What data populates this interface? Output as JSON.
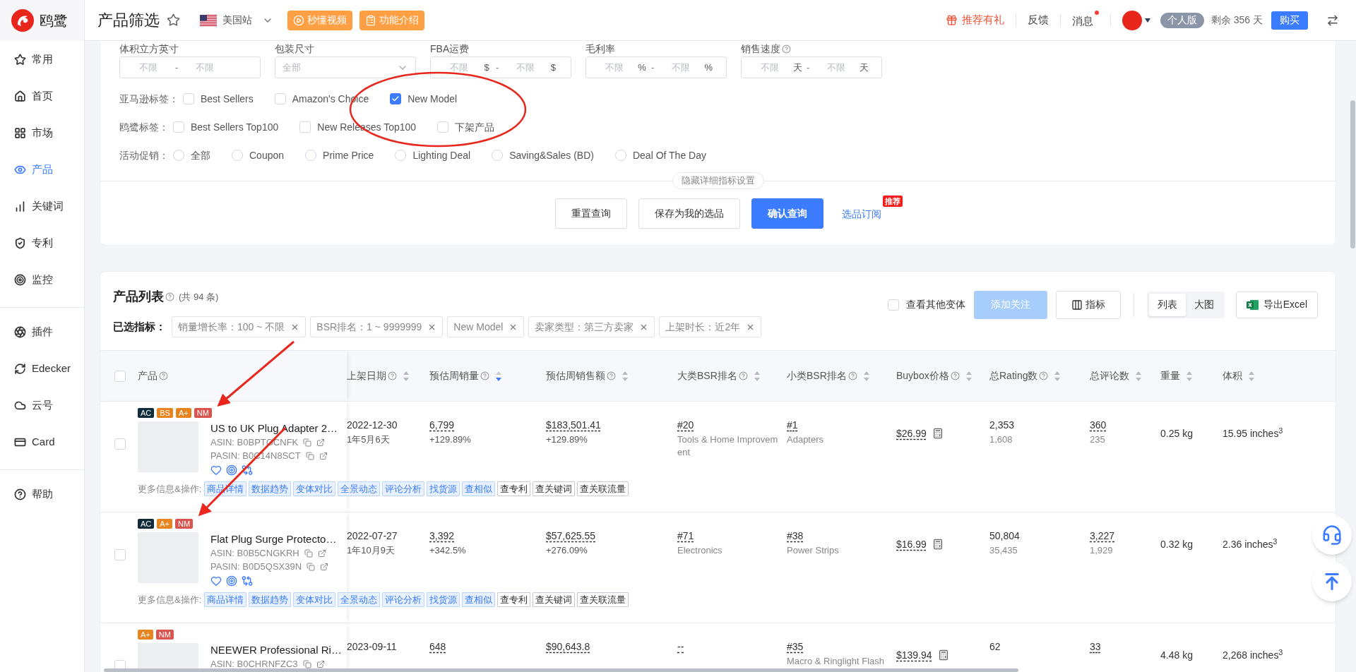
{
  "sidebar": {
    "logo": "鸥鹭",
    "sections": [
      [
        {
          "label": "常用",
          "selected": false
        },
        {
          "label": "首页",
          "selected": false
        },
        {
          "label": "市场",
          "selected": false
        },
        {
          "label": "产品",
          "selected": true
        },
        {
          "label": "关键词",
          "selected": false
        },
        {
          "label": "专利",
          "selected": false
        },
        {
          "label": "监控",
          "selected": false
        }
      ],
      [
        {
          "label": "插件",
          "selected": false
        },
        {
          "label": "Edecker",
          "selected": false
        },
        {
          "label": "云号",
          "selected": false
        },
        {
          "label": "Card",
          "selected": false
        }
      ],
      [
        {
          "label": "帮助",
          "selected": false
        }
      ]
    ]
  },
  "header": {
    "title": "产品筛选",
    "favorite": false,
    "site": "美国站",
    "guide_buttons": [
      "秒懂视频",
      "功能介绍"
    ],
    "referral": "推荐有礼",
    "feedback": "反馈",
    "messages": {
      "label": "消息",
      "unread": true
    },
    "plan": "个人版",
    "remaining": "剩余 356 天",
    "buy": "购买"
  },
  "filters": {
    "fields": [
      {
        "kind": "range",
        "label": "体积立方英寸",
        "help": false,
        "min_placeholder": "不限",
        "separator": "-",
        "max_placeholder": "不限"
      },
      {
        "kind": "select",
        "label": "包装尺寸",
        "help": false,
        "placeholder": "全部"
      },
      {
        "kind": "range",
        "label": "FBA运费",
        "help": false,
        "min_placeholder": "不限",
        "min_unit": "$",
        "separator": "-",
        "max_placeholder": "不限",
        "max_unit": "$"
      },
      {
        "kind": "range",
        "label": "毛利率",
        "help": false,
        "min_placeholder": "不限",
        "min_unit": "%",
        "separator": "-",
        "max_placeholder": "不限",
        "max_unit": "%"
      },
      {
        "kind": "range",
        "label": "销售速度",
        "help": true,
        "min_placeholder": "不限",
        "min_unit": "天",
        "separator": "-",
        "max_placeholder": "不限",
        "max_unit": "天"
      }
    ],
    "tag_groups": [
      {
        "kind": "checkbox",
        "label": "亚马逊标签：",
        "options": [
          {
            "label": "Best Sellers",
            "checked": false
          },
          {
            "label": "Amazon's Choice",
            "checked": false
          },
          {
            "label": "New Model",
            "checked": true
          }
        ]
      },
      {
        "kind": "checkbox",
        "label": "鸥鹭标签：",
        "options": [
          {
            "label": "Best Sellers Top100",
            "checked": false
          },
          {
            "label": "New Releases Top100",
            "checked": false
          },
          {
            "label": "下架产品",
            "checked": false
          }
        ]
      },
      {
        "kind": "radio",
        "label": "活动促销：",
        "options": [
          {
            "label": "全部",
            "selected": false
          },
          {
            "label": "Coupon",
            "selected": false
          },
          {
            "label": "Prime Price",
            "selected": false
          },
          {
            "label": "Lighting Deal",
            "selected": false
          },
          {
            "label": "Saving&Sales (BD)",
            "selected": false
          },
          {
            "label": "Deal Of The Day",
            "selected": false
          }
        ]
      }
    ],
    "toggle": "隐藏详细指标设置",
    "actions": [
      {
        "label": "重置查询",
        "kind": "default"
      },
      {
        "label": "保存为我的选品",
        "kind": "default"
      },
      {
        "label": "确认查询",
        "kind": "primary"
      }
    ],
    "subscribe": {
      "label": "选品订阅",
      "badge": "推荐"
    }
  },
  "product_list": {
    "title": "产品列表",
    "count": "(共 94 条)",
    "selected_label": "已选指标：",
    "chips": [
      "销量增长率：100 ~ 不限",
      "BSR排名：1 ~ 9999999",
      "New Model",
      "卖家类型：第三方卖家",
      "上架时长：近2年"
    ],
    "variants": {
      "label": "查看其他变体",
      "checked": false
    },
    "follow": {
      "label": "添加关注",
      "disabled": true
    },
    "metrics": "指标",
    "views": [
      {
        "label": "列表",
        "selected": true
      },
      {
        "label": "大图",
        "selected": false
      }
    ],
    "export": "导出Excel"
  },
  "table": {
    "product_column": {
      "label": "产品",
      "help": true,
      "checked": false
    },
    "columns": [
      {
        "label": "上架日期",
        "help": true,
        "sortable": true,
        "sorted_desc": false
      },
      {
        "label": "预估周销量",
        "help": true,
        "sortable": true,
        "sorted_desc": true
      },
      {
        "label": "预估周销售额",
        "help": true,
        "sortable": true,
        "sorted_desc": false
      },
      {
        "label": "大类BSR排名",
        "help": true,
        "sortable": true,
        "sorted_desc": false
      },
      {
        "label": "小类BSR排名",
        "help": true,
        "sortable": true,
        "sorted_desc": false
      },
      {
        "label": "Buybox价格",
        "help": true,
        "sortable": true,
        "sorted_desc": false
      },
      {
        "label": "总Rating数",
        "help": true,
        "sortable": true,
        "sorted_desc": false
      },
      {
        "label": "总评论数",
        "help": false,
        "sortable": true,
        "sorted_desc": false
      },
      {
        "label": "重量",
        "help": false,
        "sortable": true,
        "sorted_desc": false
      },
      {
        "label": "体积",
        "help": false,
        "sortable": true,
        "sorted_desc": false
      }
    ],
    "rows": [
      {
        "checked": false,
        "badges": [
          {
            "label": "AC",
            "color": "#0f2c3a"
          },
          {
            "label": "BS",
            "color": "#e8841e"
          },
          {
            "label": "A+",
            "color": "#e8841e"
          },
          {
            "label": "NM",
            "color": "#d9534f"
          }
        ],
        "title": "US to UK Plug Adapter 2…",
        "asin": "ASIN: B0BPTGCNFK",
        "pasin": "PASIN: B0C14N8SCT",
        "actions_label": "更多信息&操作:",
        "actions": [
          {
            "label": "商品详情",
            "kind": "primary"
          },
          {
            "label": "数据趋势",
            "kind": "primary"
          },
          {
            "label": "变体对比",
            "kind": "primary"
          },
          {
            "label": "全景动态",
            "kind": "primary"
          },
          {
            "label": "评论分析",
            "kind": "primary"
          },
          {
            "label": "找货源",
            "kind": "primary"
          },
          {
            "label": "查相似",
            "kind": "primary"
          },
          {
            "label": "查专利",
            "kind": "plain"
          },
          {
            "label": "查关键词",
            "kind": "plain"
          },
          {
            "label": "查关联流量",
            "kind": "plain"
          }
        ],
        "cells": [
          {
            "main": "2022-12-30",
            "sub": "1年5月6天"
          },
          {
            "main": "6,799",
            "sub": "+129.89%"
          },
          {
            "main": "$183,501.41",
            "sub": "+129.89%"
          },
          {
            "main": "#20",
            "sub": "Tools & Home Improvement"
          },
          {
            "main": "#1",
            "sub": "Adapters"
          },
          {
            "main": "$26.99"
          },
          {
            "main": "2,353",
            "sub": "1,608"
          },
          {
            "main": "360",
            "sub": "235"
          },
          {
            "main": "0.25 kg"
          },
          {
            "main": "15.95 inches$^{3}$"
          }
        ]
      },
      {
        "checked": false,
        "badges": [
          {
            "label": "AC",
            "color": "#0f2c3a"
          },
          {
            "label": "A+",
            "color": "#e8841e"
          },
          {
            "label": "NM",
            "color": "#d9534f"
          }
        ],
        "title": "Flat Plug Surge Protecto…",
        "asin": "ASIN: B0B5CNGKRH",
        "pasin": "PASIN: B0D5QSX39N",
        "actions_label": "更多信息&操作:",
        "actions": [
          {
            "label": "商品详情",
            "kind": "primary"
          },
          {
            "label": "数据趋势",
            "kind": "primary"
          },
          {
            "label": "变体对比",
            "kind": "primary"
          },
          {
            "label": "全景动态",
            "kind": "primary"
          },
          {
            "label": "评论分析",
            "kind": "primary"
          },
          {
            "label": "找货源",
            "kind": "primary"
          },
          {
            "label": "查相似",
            "kind": "primary"
          },
          {
            "label": "查专利",
            "kind": "plain"
          },
          {
            "label": "查关键词",
            "kind": "plain"
          },
          {
            "label": "查关联流量",
            "kind": "plain"
          }
        ],
        "cells": [
          {
            "main": "2022-07-27",
            "sub": "1年10月9天"
          },
          {
            "main": "3,392",
            "sub": "+342.5%"
          },
          {
            "main": "$57,625.55",
            "sub": "+276.09%"
          },
          {
            "main": "#71",
            "sub": "Electronics"
          },
          {
            "main": "#38",
            "sub": "Power Strips"
          },
          {
            "main": "$16.99"
          },
          {
            "main": "50,804",
            "sub": "35,435"
          },
          {
            "main": "3,227",
            "sub": "1,929"
          },
          {
            "main": "0.32 kg"
          },
          {
            "main": "2.36 inches$^{3}$"
          }
        ]
      },
      {
        "checked": false,
        "badges": [
          {
            "label": "A+",
            "color": "#e8841e"
          },
          {
            "label": "NM",
            "color": "#d9534f"
          }
        ],
        "title": "NEEWER Professional Ri…",
        "asin": "ASIN: B0CHRNFZC3",
        "cells": [
          {
            "main": "2023-09-11"
          },
          {
            "main": "648"
          },
          {
            "main": "$90,643.8"
          },
          {
            "main": "--"
          },
          {
            "main": "#35",
            "sub": "Macro & Ringlight Flash"
          },
          {
            "main": "$139.94"
          },
          {
            "main": "62"
          },
          {
            "main": "33"
          },
          {
            "main": "4.48 kg"
          },
          {
            "main": "2,268 inches$^{3}$"
          }
        ]
      }
    ]
  }
}
